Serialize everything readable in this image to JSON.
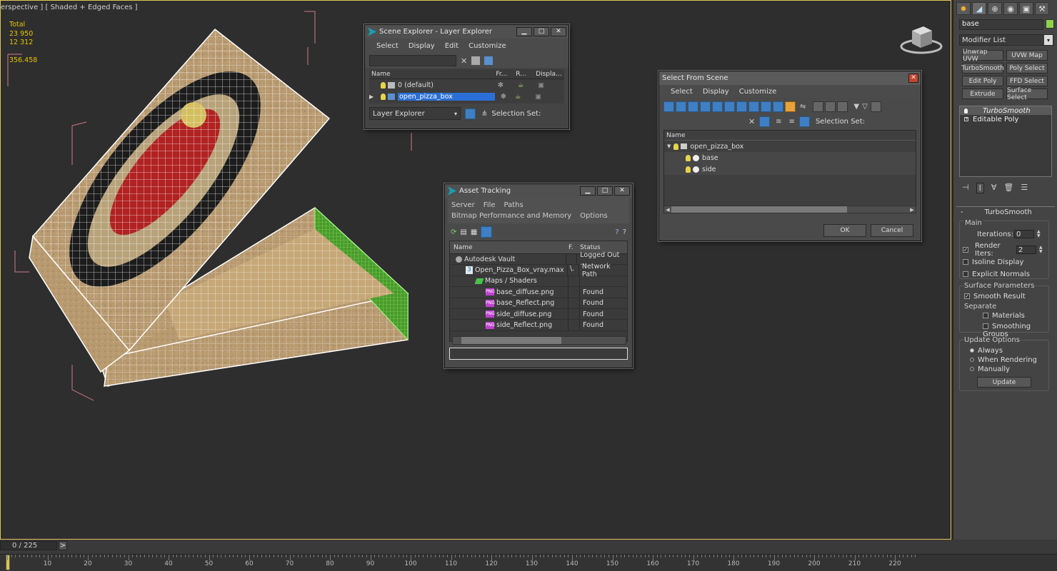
{
  "viewport": {
    "label": "erspective ] [ Shaded + Edged Faces ]",
    "stats": {
      "total_label": "Total",
      "v1": "23 950",
      "v2": "12 312",
      "v3": "356.458"
    }
  },
  "scene_explorer": {
    "title": "Scene Explorer - Layer Explorer",
    "menus": [
      "Select",
      "Display",
      "Edit",
      "Customize"
    ],
    "columns": {
      "name": "Name",
      "frozen": "Fr...",
      "render": "R...",
      "display": "Displa..."
    },
    "rows": [
      {
        "name": "0 (default)",
        "selected": false
      },
      {
        "name": "open_pizza_box",
        "selected": true
      }
    ],
    "footer_dropdown": "Layer Explorer",
    "selection_set": "Selection Set:"
  },
  "asset_tracking": {
    "title": "Asset Tracking",
    "menu_row1": [
      "Server",
      "File",
      "Paths"
    ],
    "menu_row2": [
      "Bitmap Performance and Memory",
      "Options"
    ],
    "columns": {
      "name": "Name",
      "f": "F.",
      "status": "Status"
    },
    "rows": [
      {
        "name": "Autodesk Vault",
        "f": "",
        "status": "Logged Out ...",
        "indent": 1,
        "icon": "vault-icon"
      },
      {
        "name": "Open_Pizza_Box_vray.max",
        "f": "\\.",
        "status": "Network Path",
        "indent": 2,
        "icon": "max-file-icon"
      },
      {
        "name": "Maps / Shaders",
        "f": "",
        "status": "",
        "indent": 3,
        "icon": "maps-icon"
      },
      {
        "name": "base_diffuse.png",
        "f": "",
        "status": "Found",
        "indent": 4,
        "icon": "png-icon"
      },
      {
        "name": "base_Reflect.png",
        "f": "",
        "status": "Found",
        "indent": 4,
        "icon": "png-icon"
      },
      {
        "name": "side_diffuse.png",
        "f": "",
        "status": "Found",
        "indent": 4,
        "icon": "png-icon"
      },
      {
        "name": "side_Reflect.png",
        "f": "",
        "status": "Found",
        "indent": 4,
        "icon": "png-icon"
      }
    ],
    "png_badge": "PNG",
    "max_badge": "3"
  },
  "select_from_scene": {
    "title": "Select From Scene",
    "menus": [
      "Select",
      "Display",
      "Customize"
    ],
    "selection_set": "Selection Set:",
    "column_name": "Name",
    "tree": [
      {
        "name": "open_pizza_box",
        "level": 0
      },
      {
        "name": "base",
        "level": 1
      },
      {
        "name": "side",
        "level": 1
      }
    ],
    "ok": "OK",
    "cancel": "Cancel"
  },
  "command_panel": {
    "object_name": "base",
    "modifier_list": "Modifier List",
    "mod_buttons": [
      "Unwrap UVW",
      "UVW Map",
      "TurboSmooth",
      "Poly Select",
      "Edit Poly",
      "FFD Select",
      "Extrude",
      "Surface Select"
    ],
    "stack": [
      "TurboSmooth",
      "Editable Poly"
    ],
    "rollout_title": "TurboSmooth",
    "main_label": "Main",
    "iterations_label": "Iterations:",
    "iterations_value": "0",
    "render_iters_label": "Render Iters:",
    "render_iters_value": "2",
    "isoline": "Isoline Display",
    "explicit_normals": "Explicit Normals",
    "surface_params": "Surface Parameters",
    "smooth_result": "Smooth Result",
    "separate": "Separate",
    "materials": "Materials",
    "smoothing_groups": "Smoothing Groups",
    "update_options": "Update Options",
    "always": "Always",
    "when_rendering": "When Rendering",
    "manually": "Manually",
    "update_button": "Update"
  },
  "timeline": {
    "frame_label": "0 / 225",
    "next_symbol": ">",
    "ticks": [
      "10",
      "20",
      "30",
      "40",
      "50",
      "60",
      "70",
      "80",
      "90",
      "100",
      "110",
      "120",
      "130",
      "140",
      "150",
      "160",
      "170",
      "180",
      "190",
      "200",
      "210",
      "220"
    ]
  },
  "colors": {
    "accent_blue": "#2a6fd6",
    "selection_yellow": "#e8c400",
    "green_mod": "#67c24a"
  }
}
